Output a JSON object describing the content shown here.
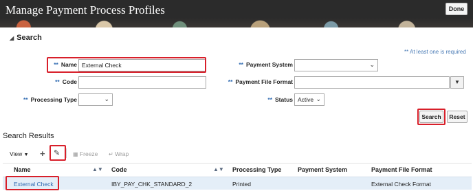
{
  "header": {
    "title": "Manage Payment Process Profiles",
    "done_label": "Done"
  },
  "search": {
    "section_title": "Search",
    "required_note": "** At least one is required",
    "name": {
      "stars": "**",
      "label": "Name",
      "value": "External Check"
    },
    "code": {
      "stars": "**",
      "label": "Code",
      "value": ""
    },
    "processing_type": {
      "stars": "**",
      "label": "Processing Type",
      "value": ""
    },
    "payment_system": {
      "stars": "**",
      "label": "Payment System",
      "value": ""
    },
    "payment_file_format": {
      "stars": "**",
      "label": "Payment File Format",
      "value": ""
    },
    "status": {
      "stars": "**",
      "label": "Status",
      "value": "Active"
    },
    "search_label": "Search",
    "reset_label": "Reset"
  },
  "results": {
    "title": "Search Results",
    "toolbar": {
      "view_label": "View",
      "freeze_label": "Freeze",
      "wrap_label": "Wrap"
    },
    "columns": [
      "Name",
      "Code",
      "Processing Type",
      "Payment System",
      "Payment File Format"
    ],
    "rows": [
      {
        "name": "External Check",
        "code": "IBY_PAY_CHK_STANDARD_2",
        "processing_type": "Printed",
        "payment_system": "",
        "payment_file_format": "External Check Format"
      }
    ]
  },
  "colors": {
    "header_bg": "#2b2b2b",
    "highlight": "#d81f2a",
    "link": "#2f6ab1",
    "row_selected": "#e4eef8"
  }
}
